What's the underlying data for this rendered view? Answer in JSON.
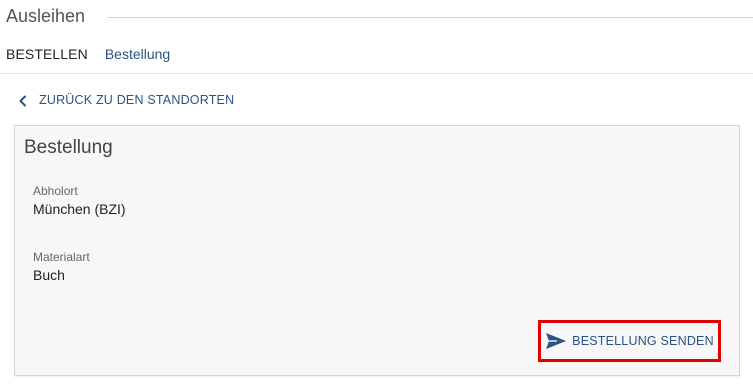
{
  "section": {
    "title": "Ausleihen"
  },
  "tabs": {
    "active": "BESTELLEN",
    "link": "Bestellung"
  },
  "back_link": {
    "label": "ZURÜCK ZU DEN STANDORTEN",
    "icon": "chevron-left-icon"
  },
  "card": {
    "title": "Bestellung",
    "fields": [
      {
        "label": "Abholort",
        "value": "München (BZI)"
      },
      {
        "label": "Materialart",
        "value": "Buch"
      }
    ],
    "submit": {
      "label": "BESTELLUNG SENDEN",
      "icon": "send-icon"
    }
  },
  "colors": {
    "link": "#2a5383",
    "highlight_border": "#e20000",
    "card_background": "#f7f7f7"
  }
}
